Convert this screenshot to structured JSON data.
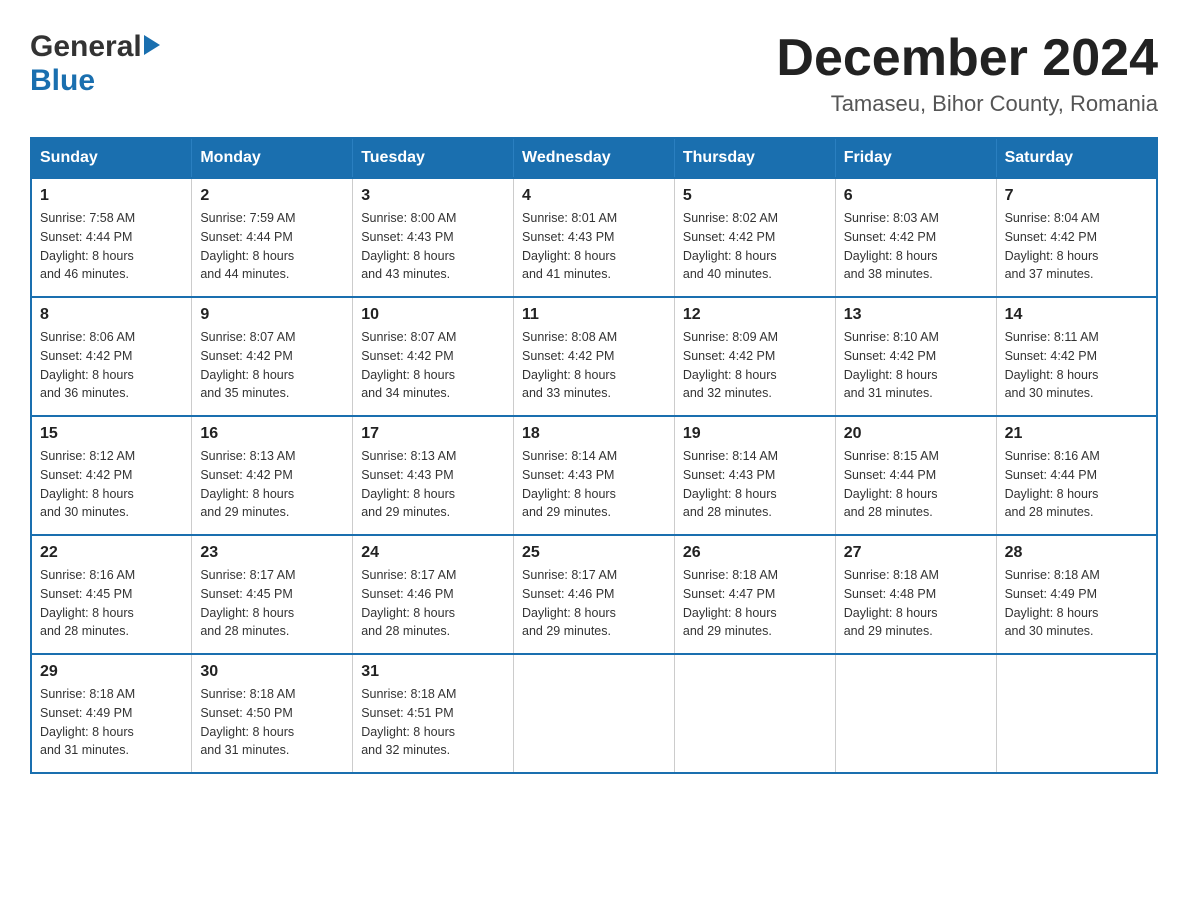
{
  "header": {
    "logo_general": "General",
    "logo_blue": "Blue",
    "month_year": "December 2024",
    "location": "Tamaseu, Bihor County, Romania"
  },
  "days_of_week": [
    "Sunday",
    "Monday",
    "Tuesday",
    "Wednesday",
    "Thursday",
    "Friday",
    "Saturday"
  ],
  "weeks": [
    [
      {
        "day": "1",
        "sunrise": "7:58 AM",
        "sunset": "4:44 PM",
        "daylight": "8 hours and 46 minutes."
      },
      {
        "day": "2",
        "sunrise": "7:59 AM",
        "sunset": "4:44 PM",
        "daylight": "8 hours and 44 minutes."
      },
      {
        "day": "3",
        "sunrise": "8:00 AM",
        "sunset": "4:43 PM",
        "daylight": "8 hours and 43 minutes."
      },
      {
        "day": "4",
        "sunrise": "8:01 AM",
        "sunset": "4:43 PM",
        "daylight": "8 hours and 41 minutes."
      },
      {
        "day": "5",
        "sunrise": "8:02 AM",
        "sunset": "4:42 PM",
        "daylight": "8 hours and 40 minutes."
      },
      {
        "day": "6",
        "sunrise": "8:03 AM",
        "sunset": "4:42 PM",
        "daylight": "8 hours and 38 minutes."
      },
      {
        "day": "7",
        "sunrise": "8:04 AM",
        "sunset": "4:42 PM",
        "daylight": "8 hours and 37 minutes."
      }
    ],
    [
      {
        "day": "8",
        "sunrise": "8:06 AM",
        "sunset": "4:42 PM",
        "daylight": "8 hours and 36 minutes."
      },
      {
        "day": "9",
        "sunrise": "8:07 AM",
        "sunset": "4:42 PM",
        "daylight": "8 hours and 35 minutes."
      },
      {
        "day": "10",
        "sunrise": "8:07 AM",
        "sunset": "4:42 PM",
        "daylight": "8 hours and 34 minutes."
      },
      {
        "day": "11",
        "sunrise": "8:08 AM",
        "sunset": "4:42 PM",
        "daylight": "8 hours and 33 minutes."
      },
      {
        "day": "12",
        "sunrise": "8:09 AM",
        "sunset": "4:42 PM",
        "daylight": "8 hours and 32 minutes."
      },
      {
        "day": "13",
        "sunrise": "8:10 AM",
        "sunset": "4:42 PM",
        "daylight": "8 hours and 31 minutes."
      },
      {
        "day": "14",
        "sunrise": "8:11 AM",
        "sunset": "4:42 PM",
        "daylight": "8 hours and 30 minutes."
      }
    ],
    [
      {
        "day": "15",
        "sunrise": "8:12 AM",
        "sunset": "4:42 PM",
        "daylight": "8 hours and 30 minutes."
      },
      {
        "day": "16",
        "sunrise": "8:13 AM",
        "sunset": "4:42 PM",
        "daylight": "8 hours and 29 minutes."
      },
      {
        "day": "17",
        "sunrise": "8:13 AM",
        "sunset": "4:43 PM",
        "daylight": "8 hours and 29 minutes."
      },
      {
        "day": "18",
        "sunrise": "8:14 AM",
        "sunset": "4:43 PM",
        "daylight": "8 hours and 29 minutes."
      },
      {
        "day": "19",
        "sunrise": "8:14 AM",
        "sunset": "4:43 PM",
        "daylight": "8 hours and 28 minutes."
      },
      {
        "day": "20",
        "sunrise": "8:15 AM",
        "sunset": "4:44 PM",
        "daylight": "8 hours and 28 minutes."
      },
      {
        "day": "21",
        "sunrise": "8:16 AM",
        "sunset": "4:44 PM",
        "daylight": "8 hours and 28 minutes."
      }
    ],
    [
      {
        "day": "22",
        "sunrise": "8:16 AM",
        "sunset": "4:45 PM",
        "daylight": "8 hours and 28 minutes."
      },
      {
        "day": "23",
        "sunrise": "8:17 AM",
        "sunset": "4:45 PM",
        "daylight": "8 hours and 28 minutes."
      },
      {
        "day": "24",
        "sunrise": "8:17 AM",
        "sunset": "4:46 PM",
        "daylight": "8 hours and 28 minutes."
      },
      {
        "day": "25",
        "sunrise": "8:17 AM",
        "sunset": "4:46 PM",
        "daylight": "8 hours and 29 minutes."
      },
      {
        "day": "26",
        "sunrise": "8:18 AM",
        "sunset": "4:47 PM",
        "daylight": "8 hours and 29 minutes."
      },
      {
        "day": "27",
        "sunrise": "8:18 AM",
        "sunset": "4:48 PM",
        "daylight": "8 hours and 29 minutes."
      },
      {
        "day": "28",
        "sunrise": "8:18 AM",
        "sunset": "4:49 PM",
        "daylight": "8 hours and 30 minutes."
      }
    ],
    [
      {
        "day": "29",
        "sunrise": "8:18 AM",
        "sunset": "4:49 PM",
        "daylight": "8 hours and 31 minutes."
      },
      {
        "day": "30",
        "sunrise": "8:18 AM",
        "sunset": "4:50 PM",
        "daylight": "8 hours and 31 minutes."
      },
      {
        "day": "31",
        "sunrise": "8:18 AM",
        "sunset": "4:51 PM",
        "daylight": "8 hours and 32 minutes."
      },
      null,
      null,
      null,
      null
    ]
  ],
  "labels": {
    "sunrise_prefix": "Sunrise: ",
    "sunset_prefix": "Sunset: ",
    "daylight_prefix": "Daylight: "
  }
}
